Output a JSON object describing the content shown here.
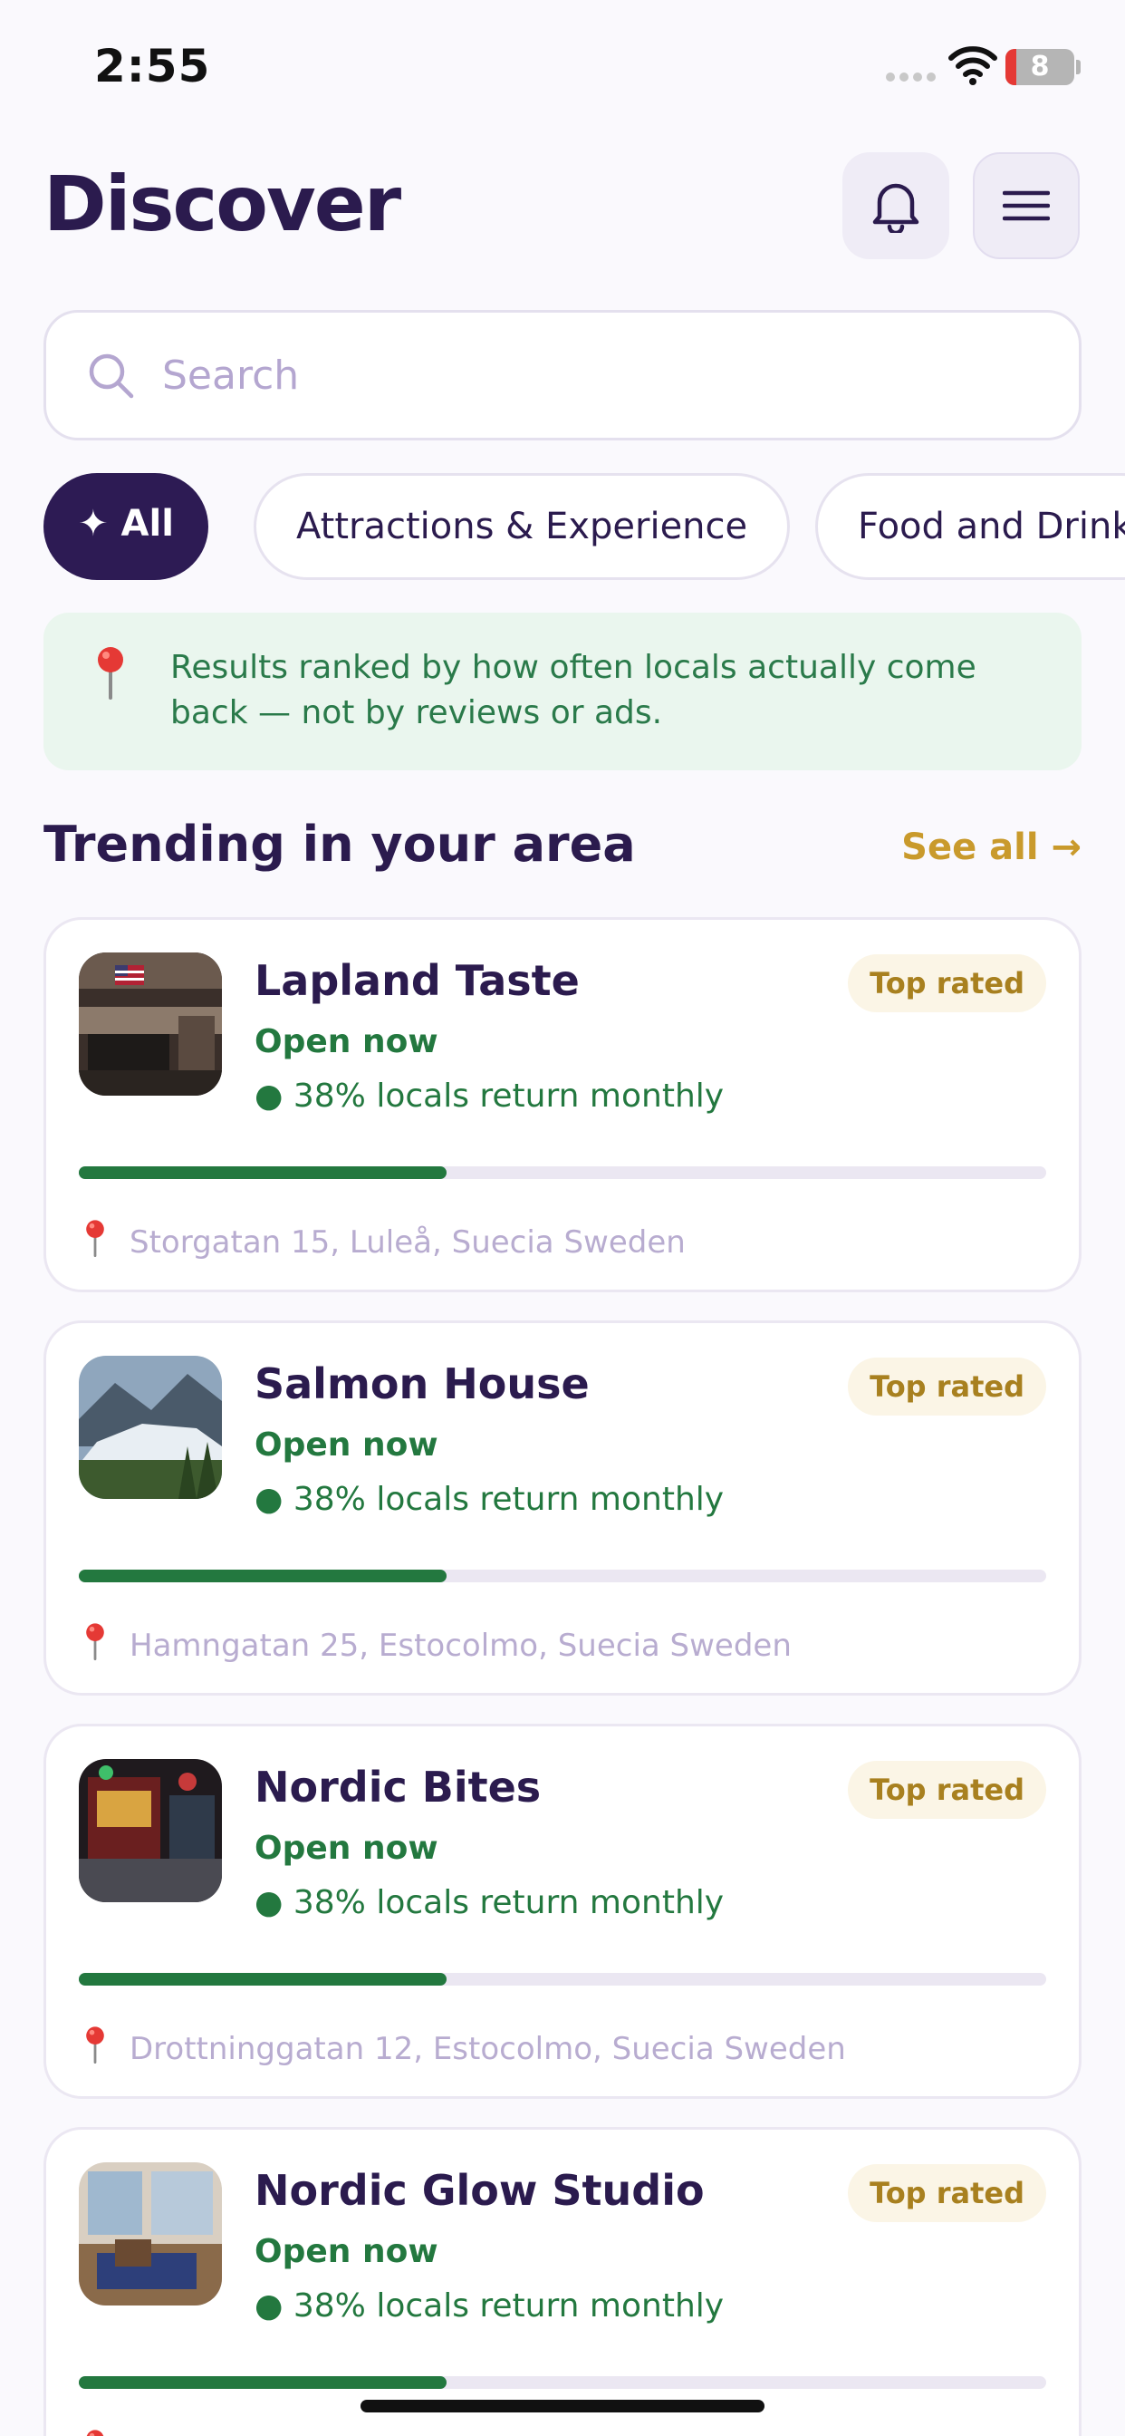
{
  "status_bar": {
    "time": "2:55",
    "battery": "8"
  },
  "header": {
    "title": "Discover"
  },
  "search": {
    "placeholder": "Search"
  },
  "filters": [
    {
      "label": "✦ All",
      "active": true
    },
    {
      "label": "Attractions & Experience",
      "active": false
    },
    {
      "label": "Food and Drink",
      "active": false
    }
  ],
  "info_banner": {
    "text": "Results ranked by how often locals actually come back — not by reviews or ads."
  },
  "section": {
    "title": "Trending in your area",
    "see_all": "See all →"
  },
  "places": [
    {
      "name": "Lapland Taste",
      "badge": "Top rated",
      "status": "Open now",
      "return_rate": "● 38% locals return monthly",
      "return_fraction": 0.38,
      "address": "Storgatan 15, Luleå, Suecia Sweden",
      "thumb": "restaurant-interior"
    },
    {
      "name": "Salmon House",
      "badge": "Top rated",
      "status": "Open now",
      "return_rate": "● 38% locals return monthly",
      "return_fraction": 0.38,
      "address": "Hamngatan 25, Estocolmo, Suecia Sweden",
      "thumb": "glacier-landscape"
    },
    {
      "name": "Nordic Bites",
      "badge": "Top rated",
      "status": "Open now",
      "return_rate": "● 38% locals return monthly",
      "return_fraction": 0.38,
      "address": "Drottninggatan 12, Estocolmo, Suecia Sweden",
      "thumb": "street-storefront"
    },
    {
      "name": "Nordic Glow Studio",
      "badge": "Top rated",
      "status": "Open now",
      "return_rate": "● 38% locals return monthly",
      "return_fraction": 0.38,
      "address": "",
      "thumb": "hotel-room"
    }
  ],
  "colors": {
    "primary": "#2d1b54",
    "success": "#23783f",
    "accent": "#c99a2c",
    "banner_bg": "#eaf6ee"
  }
}
